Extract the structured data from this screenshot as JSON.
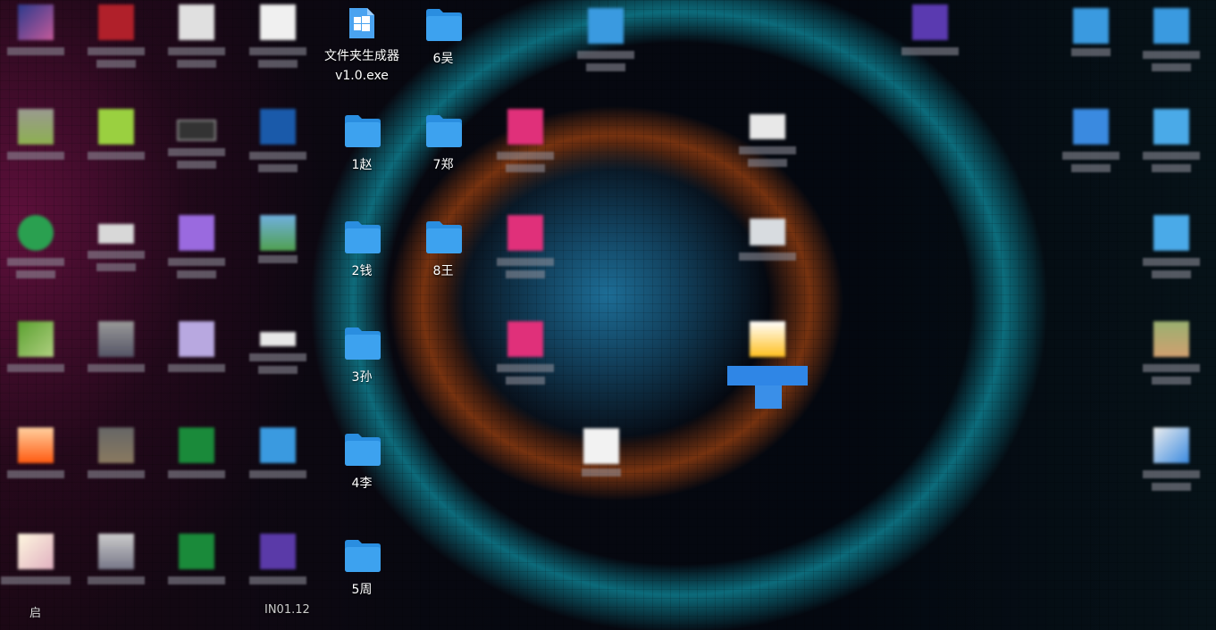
{
  "desktop": {
    "clear_icons": [
      {
        "id": "exe",
        "label": "文件夹生成器v1.0.exe",
        "icon": "exe-windows-icon"
      },
      {
        "id": "f6",
        "label": "6吴",
        "icon": "folder-icon"
      },
      {
        "id": "f1",
        "label": "1赵",
        "icon": "folder-icon"
      },
      {
        "id": "f7",
        "label": "7郑",
        "icon": "folder-icon"
      },
      {
        "id": "f2",
        "label": "2钱",
        "icon": "folder-icon"
      },
      {
        "id": "f8",
        "label": "8王",
        "icon": "folder-icon"
      },
      {
        "id": "f3",
        "label": "3孙",
        "icon": "folder-icon"
      },
      {
        "id": "f4",
        "label": "4李",
        "icon": "folder-icon"
      },
      {
        "id": "f5",
        "label": "5周",
        "icon": "folder-icon"
      }
    ],
    "partial_labels": {
      "bottom_left": "启",
      "bottom_col4": "IN01.12"
    },
    "colors": {
      "folder_blue": "#3da2ef",
      "folder_tab": "#2a8ee0",
      "selection": "#2f86e6",
      "label": "#ffffff"
    }
  }
}
